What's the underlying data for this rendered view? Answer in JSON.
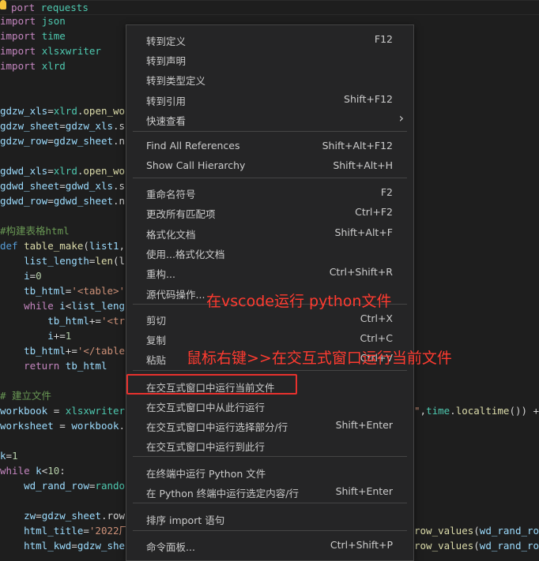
{
  "code_lines": [
    {
      "segments": [
        {
          "t": "port",
          "c": "kw"
        },
        {
          "t": " ",
          "c": "plain"
        },
        {
          "t": "requests",
          "c": "mod"
        }
      ]
    },
    {
      "segments": [
        {
          "t": "import",
          "c": "kw"
        },
        {
          "t": " ",
          "c": "plain"
        },
        {
          "t": "json",
          "c": "mod"
        }
      ]
    },
    {
      "segments": [
        {
          "t": "import",
          "c": "kw"
        },
        {
          "t": " ",
          "c": "plain"
        },
        {
          "t": "time",
          "c": "mod"
        }
      ]
    },
    {
      "segments": [
        {
          "t": "import",
          "c": "kw"
        },
        {
          "t": " ",
          "c": "plain"
        },
        {
          "t": "xlsxwriter",
          "c": "mod"
        }
      ]
    },
    {
      "segments": [
        {
          "t": "import",
          "c": "kw"
        },
        {
          "t": " ",
          "c": "plain"
        },
        {
          "t": "xlrd",
          "c": "mod"
        }
      ]
    },
    {
      "segments": []
    },
    {
      "segments": []
    },
    {
      "segments": [
        {
          "t": "gdzw_xls",
          "c": "var"
        },
        {
          "t": "=",
          "c": "plain"
        },
        {
          "t": "xlrd",
          "c": "mod"
        },
        {
          "t": ".",
          "c": "plain"
        },
        {
          "t": "open_wo",
          "c": "fn"
        }
      ]
    },
    {
      "segments": [
        {
          "t": "gdzw_sheet",
          "c": "var"
        },
        {
          "t": "=",
          "c": "plain"
        },
        {
          "t": "gdzw_xls",
          "c": "var"
        },
        {
          "t": ".s",
          "c": "plain"
        }
      ]
    },
    {
      "segments": [
        {
          "t": "gdzw_row",
          "c": "var"
        },
        {
          "t": "=",
          "c": "plain"
        },
        {
          "t": "gdzw_sheet",
          "c": "var"
        },
        {
          "t": ".n",
          "c": "plain"
        }
      ]
    },
    {
      "segments": []
    },
    {
      "segments": [
        {
          "t": "gdwd_xls",
          "c": "var"
        },
        {
          "t": "=",
          "c": "plain"
        },
        {
          "t": "xlrd",
          "c": "mod"
        },
        {
          "t": ".",
          "c": "plain"
        },
        {
          "t": "open_wo",
          "c": "fn"
        }
      ]
    },
    {
      "segments": [
        {
          "t": "gdwd_sheet",
          "c": "var"
        },
        {
          "t": "=",
          "c": "plain"
        },
        {
          "t": "gdwd_xls",
          "c": "var"
        },
        {
          "t": ".s",
          "c": "plain"
        }
      ]
    },
    {
      "segments": [
        {
          "t": "gdwd_row",
          "c": "var"
        },
        {
          "t": "=",
          "c": "plain"
        },
        {
          "t": "gdwd_sheet",
          "c": "var"
        },
        {
          "t": ".n",
          "c": "plain"
        }
      ]
    },
    {
      "segments": []
    },
    {
      "segments": [
        {
          "t": "#构建表格html",
          "c": "cmt"
        }
      ]
    },
    {
      "segments": [
        {
          "t": "def",
          "c": "kw2"
        },
        {
          "t": " ",
          "c": "plain"
        },
        {
          "t": "table_make",
          "c": "fn"
        },
        {
          "t": "(",
          "c": "plain"
        },
        {
          "t": "list1",
          "c": "var"
        },
        {
          "t": ",",
          "c": "plain"
        }
      ]
    },
    {
      "segments": [
        {
          "t": "    list_length",
          "c": "var"
        },
        {
          "t": "=",
          "c": "plain"
        },
        {
          "t": "len",
          "c": "fn"
        },
        {
          "t": "(l",
          "c": "plain"
        }
      ]
    },
    {
      "segments": [
        {
          "t": "    i",
          "c": "var"
        },
        {
          "t": "=",
          "c": "plain"
        },
        {
          "t": "0",
          "c": "num"
        }
      ]
    },
    {
      "segments": [
        {
          "t": "    tb_html",
          "c": "var"
        },
        {
          "t": "=",
          "c": "plain"
        },
        {
          "t": "'<table>'",
          "c": "str"
        }
      ]
    },
    {
      "segments": [
        {
          "t": "    while",
          "c": "kw"
        },
        {
          "t": " ",
          "c": "plain"
        },
        {
          "t": "i",
          "c": "var"
        },
        {
          "t": "<",
          "c": "plain"
        },
        {
          "t": "list_leng",
          "c": "var"
        }
      ]
    },
    {
      "segments": [
        {
          "t": "        tb_html",
          "c": "var"
        },
        {
          "t": "+=",
          "c": "plain"
        },
        {
          "t": "'<tr",
          "c": "str"
        }
      ]
    },
    {
      "segments": [
        {
          "t": "        i",
          "c": "var"
        },
        {
          "t": "+=",
          "c": "plain"
        },
        {
          "t": "1",
          "c": "num"
        }
      ]
    },
    {
      "segments": [
        {
          "t": "    tb_html",
          "c": "var"
        },
        {
          "t": "+=",
          "c": "plain"
        },
        {
          "t": "'</table",
          "c": "str"
        }
      ]
    },
    {
      "segments": [
        {
          "t": "    return",
          "c": "kw"
        },
        {
          "t": " ",
          "c": "plain"
        },
        {
          "t": "tb_html",
          "c": "var"
        }
      ]
    },
    {
      "segments": []
    },
    {
      "segments": [
        {
          "t": "# 建立文件",
          "c": "cmt"
        }
      ]
    },
    {
      "segments": [
        {
          "t": "workbook",
          "c": "var"
        },
        {
          "t": " = ",
          "c": "plain"
        },
        {
          "t": "xlsxwriter",
          "c": "mod"
        }
      ]
    },
    {
      "segments": [
        {
          "t": "worksheet",
          "c": "var"
        },
        {
          "t": " = ",
          "c": "plain"
        },
        {
          "t": "workbook",
          "c": "var"
        },
        {
          "t": ".",
          "c": "plain"
        }
      ]
    },
    {
      "segments": []
    },
    {
      "segments": [
        {
          "t": "k",
          "c": "var"
        },
        {
          "t": "=",
          "c": "plain"
        },
        {
          "t": "1",
          "c": "num"
        }
      ]
    },
    {
      "segments": [
        {
          "t": "while",
          "c": "kw"
        },
        {
          "t": " ",
          "c": "plain"
        },
        {
          "t": "k",
          "c": "var"
        },
        {
          "t": "<",
          "c": "plain"
        },
        {
          "t": "10",
          "c": "num"
        },
        {
          "t": ":",
          "c": "plain"
        }
      ]
    },
    {
      "segments": [
        {
          "t": "    wd_rand_row",
          "c": "var"
        },
        {
          "t": "=",
          "c": "plain"
        },
        {
          "t": "rando",
          "c": "mod"
        }
      ]
    },
    {
      "segments": []
    },
    {
      "segments": [
        {
          "t": "    zw",
          "c": "var"
        },
        {
          "t": "=",
          "c": "plain"
        },
        {
          "t": "gdzw_sheet",
          "c": "var"
        },
        {
          "t": ".row",
          "c": "plain"
        }
      ]
    },
    {
      "segments": [
        {
          "t": "    html_title",
          "c": "var"
        },
        {
          "t": "=",
          "c": "plain"
        },
        {
          "t": "'2022厂",
          "c": "str"
        }
      ]
    },
    {
      "segments": [
        {
          "t": "    html_kwd",
          "c": "var"
        },
        {
          "t": "=",
          "c": "plain"
        },
        {
          "t": "gdzw_she",
          "c": "var"
        }
      ]
    }
  ],
  "right_fragments": [
    {
      "segments": [
        {
          "t": "\"",
          "c": "str"
        },
        {
          "t": ",",
          "c": "plain"
        },
        {
          "t": "time",
          "c": "mod"
        },
        {
          "t": ".",
          "c": "plain"
        },
        {
          "t": "localtime",
          "c": "fn"
        },
        {
          "t": "()) +",
          "c": "plain"
        }
      ]
    },
    {
      "segments": [
        {
          "t": "row_values",
          "c": "fn"
        },
        {
          "t": "(",
          "c": "plain"
        },
        {
          "t": "wd_rand_ro",
          "c": "var"
        }
      ]
    },
    {
      "segments": [
        {
          "t": "row_values",
          "c": "fn"
        },
        {
          "t": "(",
          "c": "plain"
        },
        {
          "t": "wd_rand_ro",
          "c": "var"
        }
      ]
    }
  ],
  "menu": {
    "items": [
      {
        "label": "转到定义",
        "key": "F12"
      },
      {
        "label": "转到声明",
        "key": ""
      },
      {
        "label": "转到类型定义",
        "key": ""
      },
      {
        "label": "转到引用",
        "key": "Shift+F12"
      },
      {
        "label": "快速查看",
        "key": "",
        "submenu": "chevron-right-icon"
      },
      {
        "label": "Find All References",
        "key": "Shift+Alt+F12"
      },
      {
        "label": "Show Call Hierarchy",
        "key": "Shift+Alt+H"
      },
      {
        "label": "重命名符号",
        "key": "F2"
      },
      {
        "label": "更改所有匹配项",
        "key": "Ctrl+F2"
      },
      {
        "label": "格式化文档",
        "key": "Shift+Alt+F"
      },
      {
        "label": "使用...格式化文档",
        "key": ""
      },
      {
        "label": "重构...",
        "key": "Ctrl+Shift+R"
      },
      {
        "label": "源代码操作...",
        "key": ""
      },
      {
        "label": "剪切",
        "key": "Ctrl+X"
      },
      {
        "label": "复制",
        "key": "Ctrl+C"
      },
      {
        "label": "粘贴",
        "key": "Ctrl+V"
      },
      {
        "label": "在交互式窗口中运行当前文件",
        "key": ""
      },
      {
        "label": "在交互式窗口中从此行运行",
        "key": ""
      },
      {
        "label": "在交互式窗口中运行选择部分/行",
        "key": "Shift+Enter"
      },
      {
        "label": "在交互式窗口中运行到此行",
        "key": ""
      },
      {
        "label": "在终端中运行 Python 文件",
        "key": ""
      },
      {
        "label": "在 Python 终端中运行选定内容/行",
        "key": "Shift+Enter"
      },
      {
        "label": "排序 import 语句",
        "key": ""
      },
      {
        "label": "命令面板...",
        "key": "Ctrl+Shift+P"
      }
    ]
  },
  "annotations": {
    "top": "在vscode运行 python文件",
    "bottom": "鼠标右键>>在交互式窗口运行当前文件",
    "color": "#ff3b30"
  },
  "theme": {
    "editor_bg": "#1e1e1e",
    "menu_bg": "#252526",
    "highlight_border": "#e8312d"
  }
}
